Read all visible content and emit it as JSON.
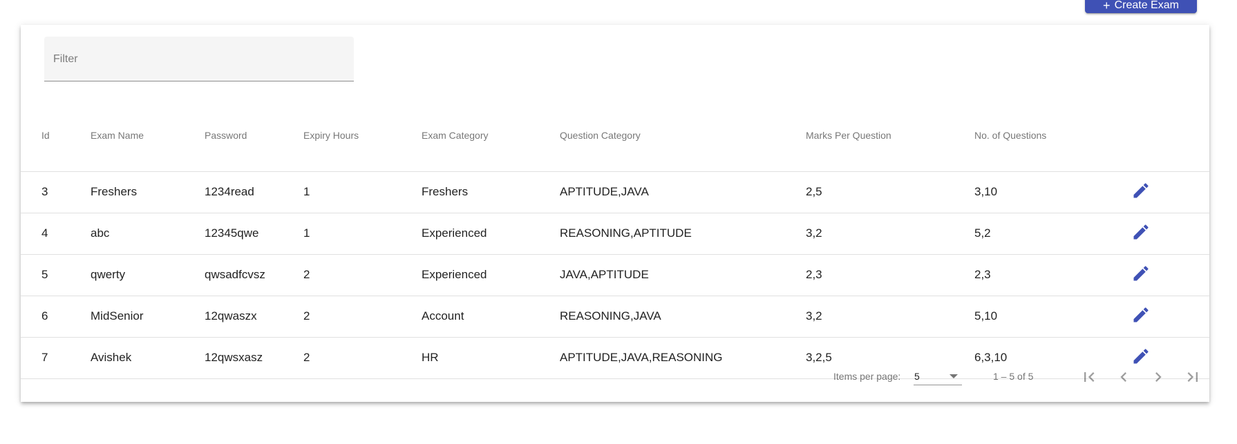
{
  "toolbar": {
    "create_label": "Create Exam",
    "create_icon": "plus-icon"
  },
  "filter": {
    "placeholder": "Filter"
  },
  "table": {
    "headers": [
      "Id",
      "Exam Name",
      "Password",
      "Expiry Hours",
      "Exam Category",
      "Question Category",
      "Marks Per Question",
      "No. of Questions"
    ],
    "rows": [
      {
        "id": "3",
        "name": "Freshers",
        "password": "1234read",
        "expiry": "1",
        "exam_category": "Freshers",
        "question_category": "APTITUDE,JAVA",
        "marks": "2,5",
        "questions": "3,10"
      },
      {
        "id": "4",
        "name": "abc",
        "password": "12345qwe",
        "expiry": "1",
        "exam_category": "Experienced",
        "question_category": "REASONING,APTITUDE",
        "marks": "3,2",
        "questions": "5,2"
      },
      {
        "id": "5",
        "name": "qwerty",
        "password": "qwsadfcvsz",
        "expiry": "2",
        "exam_category": "Experienced",
        "question_category": "JAVA,APTITUDE",
        "marks": "2,3",
        "questions": "2,3"
      },
      {
        "id": "6",
        "name": "MidSenior",
        "password": "12qwaszx",
        "expiry": "2",
        "exam_category": "Account",
        "question_category": "REASONING,JAVA",
        "marks": "3,2",
        "questions": "5,10"
      },
      {
        "id": "7",
        "name": "Avishek",
        "password": "12qwsxasz",
        "expiry": "2",
        "exam_category": "HR",
        "question_category": "APTITUDE,JAVA,REASONING",
        "marks": "3,2,5",
        "questions": "6,3,10"
      }
    ]
  },
  "paginator": {
    "items_per_page_label": "Items per page:",
    "page_size": "5",
    "range_label": "1 – 5 of 5"
  },
  "colors": {
    "accent": "#3f51b5"
  }
}
